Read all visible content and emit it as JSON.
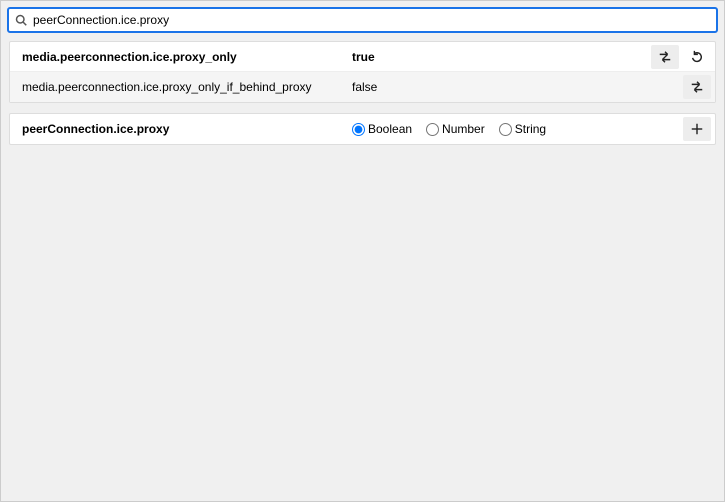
{
  "search": {
    "value": "peerConnection.ice.proxy",
    "placeholder": ""
  },
  "prefs": [
    {
      "name": "media.peerconnection.ice.proxy_only",
      "value": "true",
      "modified": true,
      "has_reset": true,
      "alt": false
    },
    {
      "name": "media.peerconnection.ice.proxy_only_if_behind_proxy",
      "value": "false",
      "modified": false,
      "has_reset": false,
      "alt": true
    }
  ],
  "add_row": {
    "name": "peerConnection.ice.proxy",
    "types": [
      "Boolean",
      "Number",
      "String"
    ],
    "selected": "Boolean"
  },
  "icons": {
    "search": "search-icon",
    "toggle": "toggle-icon",
    "reset": "reset-icon",
    "add": "add-icon"
  }
}
